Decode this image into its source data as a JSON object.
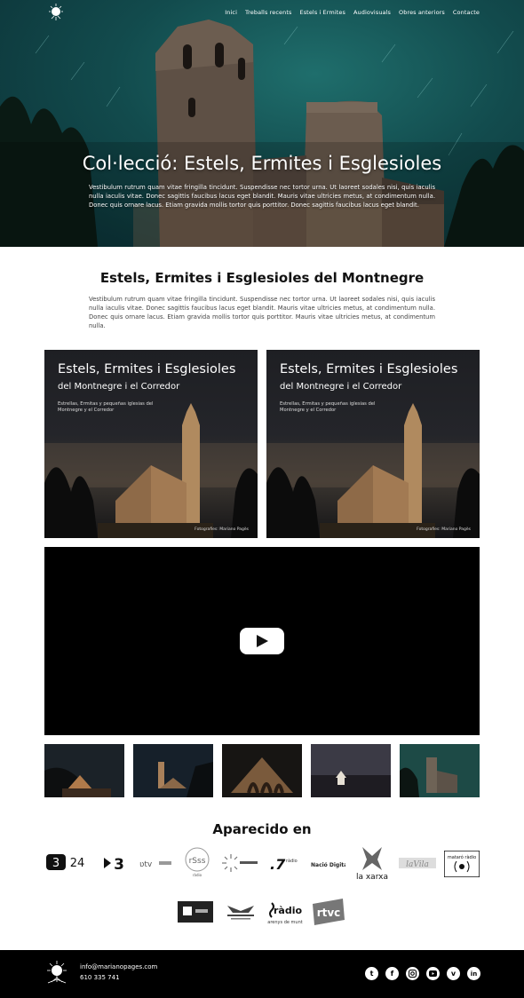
{
  "nav": {
    "items": [
      "Inici",
      "Treballs recents",
      "Estels i Ermites",
      "Audiovisuals",
      "Obres anteriors",
      "Contacte"
    ]
  },
  "hero": {
    "title": "Col·lecció: Estels, Ermites i Esglesioles",
    "text": "Vestibulum rutrum quam vitae fringilla tincidunt. Suspendisse nec tortor urna. Ut laoreet sodales nisi, quis iaculis nulla iaculis vitae. Donec sagittis faucibus lacus eget blandit. Mauris vitae ultricies metus, at condimentum nulla. Donec quis ornare lacus. Etiam gravida mollis tortor quis porttitor. Donec sagittis faucibus lacus eget blandit."
  },
  "section": {
    "title": "Estels, Ermites i Esglesioles del Montnegre",
    "text": "Vestibulum rutrum quam vitae fringilla tincidunt. Suspendisse nec tortor urna. Ut laoreet sodales nisi, quis iaculis nulla iaculis vitae. Donec sagittis faucibus lacus eget blandit. Mauris vitae ultricies metus, at condimentum nulla. Donec quis ornare lacus. Etiam gravida mollis tortor quis porttitor. Mauris vitae ultricies metus, at condimentum nulla."
  },
  "cover": {
    "title": "Estels, Ermites i Esglesioles",
    "subtitle": "del Montnegre i el Corredor",
    "desc": "Estrellas, Ermitas y pequeñas iglesias del Montnegre y el Corredor",
    "credit": "Fotografies: Mariano Pagès"
  },
  "appeared": {
    "title": "Aparecido en",
    "logos": [
      "3/24",
      "3",
      "betevé",
      "rSss ràdio",
      "ràdio vilamajor",
      "7 ràdio",
      "Nació Digital",
      "la xarxa",
      "laVila",
      "mataró ràdio",
      "tv",
      "casa de cultura",
      "ràdio arenys de munt",
      "rtvc"
    ]
  },
  "footer": {
    "email": "info@marianopages.com",
    "phone": "610 335 741",
    "social": [
      "twitter-icon",
      "facebook-icon",
      "instagram-icon",
      "youtube-icon",
      "vimeo-icon",
      "linkedin-icon"
    ]
  },
  "colors": {
    "hero_teal": "#124b4d",
    "footer_bg": "#000000",
    "video_bg": "#000000"
  }
}
